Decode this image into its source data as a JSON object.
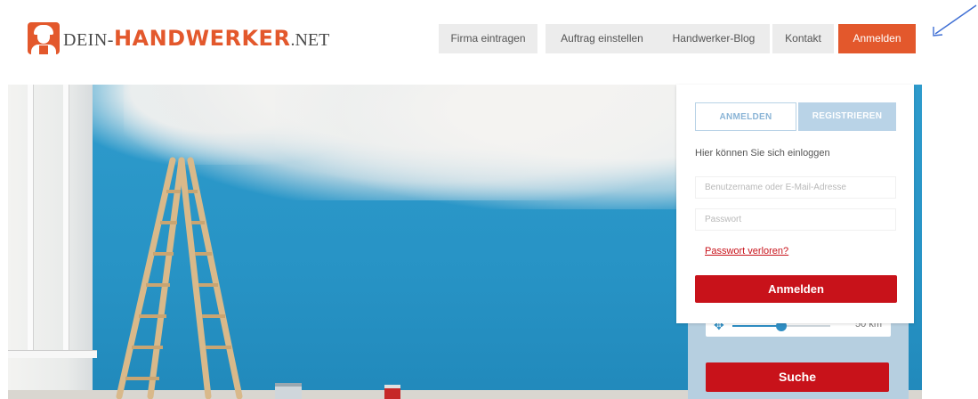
{
  "logo": {
    "prefix": "DEIN-",
    "main": "HANDWERKER",
    "suffix": ".NET"
  },
  "nav": [
    {
      "label": "Firma eintragen"
    },
    {
      "label": "Auftrag einstellen"
    },
    {
      "label": "Handwerker-Blog"
    },
    {
      "label": "Kontakt"
    },
    {
      "label": "Anmelden"
    }
  ],
  "login_panel": {
    "tab_login": "ANMELDEN",
    "tab_register": "REGISTRIEREN",
    "info": "Hier können Sie sich einloggen",
    "username_placeholder": "Benutzername oder E-Mail-Adresse",
    "password_placeholder": "Passwort",
    "lost_password": "Passwort verloren?",
    "submit": "Anmelden"
  },
  "search_panel": {
    "radius_value": 50,
    "radius_label": "50 km",
    "radius_fill_fraction": 0.5,
    "submit": "Suche"
  },
  "colors": {
    "brand": "#e3582c",
    "action_red": "#c8121a",
    "tab_blue": "#b9d3e7",
    "wall_blue": "#2a97c9"
  },
  "icons": {
    "location": "crosshair-icon",
    "arrow": "annotation-arrow"
  }
}
